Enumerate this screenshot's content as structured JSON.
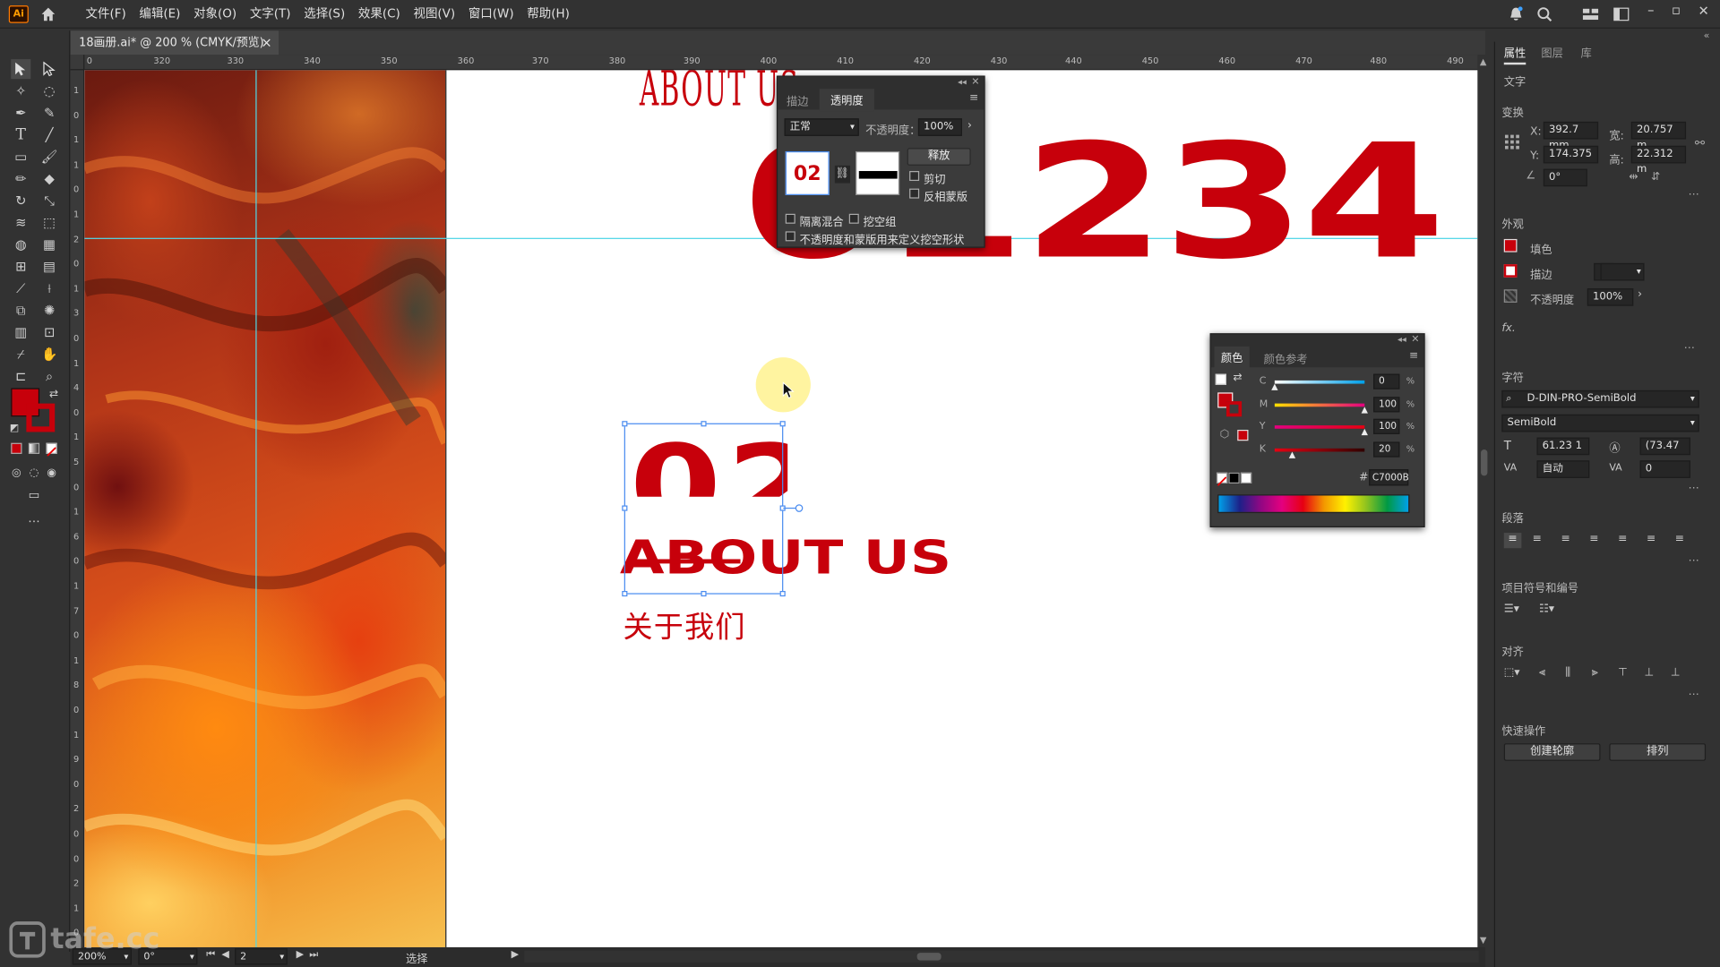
{
  "app": {
    "logo_text": "Ai"
  },
  "menu": [
    "文件(F)",
    "编辑(E)",
    "对象(O)",
    "文字(T)",
    "选择(S)",
    "效果(C)",
    "视图(V)",
    "窗口(W)",
    "帮助(H)"
  ],
  "document_tab": {
    "title": "18画册.ai* @ 200 % (CMYK/预览)",
    "close": "×"
  },
  "ruler": {
    "h_ticks": [
      "0",
      "320",
      "330",
      "340",
      "350",
      "360",
      "370",
      "380",
      "390",
      "400",
      "410",
      "420",
      "430",
      "440",
      "450",
      "460",
      "470",
      "480",
      "490"
    ],
    "v_ticks": [
      "1",
      "0",
      "1",
      "1",
      "0",
      "1",
      "2",
      "0",
      "1",
      "3",
      "0",
      "1",
      "4",
      "0",
      "1",
      "5",
      "0",
      "1",
      "6",
      "0",
      "1",
      "7",
      "0",
      "1",
      "8",
      "0",
      "1",
      "9",
      "0",
      "2",
      "0",
      "0",
      "2",
      "1",
      "0"
    ]
  },
  "canvas": {
    "about_top": "ABOUT US",
    "number_big": "01234",
    "number_02": "02",
    "about_us": "ABOUT US",
    "about_cn": "关于我们",
    "watermark": "tafe.cc"
  },
  "transparency_panel": {
    "tab_stroke": "描边",
    "tab_transparency": "透明度",
    "blend_mode": "正常",
    "opacity_label": "不透明度：",
    "opacity_value": "100%",
    "thumb_text": "02",
    "release_button": "释放",
    "clip_label": "剪切",
    "invert_label": "反相蒙版",
    "isolate_label": "隔离混合",
    "knockout_label": "挖空组",
    "define_knockout_label": "不透明度和蒙版用来定义挖空形状"
  },
  "color_panel": {
    "tab_color": "颜色",
    "tab_guide": "颜色参考",
    "channels": [
      {
        "label": "C",
        "value": "0",
        "unit": "%",
        "level": 0,
        "color_start": "#ffffff",
        "color_end": "#00a0e9"
      },
      {
        "label": "M",
        "value": "100",
        "unit": "%",
        "level": 1.0,
        "color_start": "#ffe000",
        "color_end": "#e4007f"
      },
      {
        "label": "Y",
        "value": "100",
        "unit": "%",
        "level": 1.0,
        "color_start": "#e4007f",
        "color_end": "#e60012"
      },
      {
        "label": "K",
        "value": "20",
        "unit": "%",
        "level": 0.2,
        "color_start": "#e60012",
        "color_end": "#300000"
      }
    ],
    "hex_label": "#",
    "hex_value": "C7000B"
  },
  "right_panel": {
    "tabs": [
      "属性",
      "图层",
      "库"
    ],
    "section_type": "文字",
    "transform": {
      "title": "变换",
      "x_label": "X:",
      "x_value": "392.7 mm",
      "y_label": "Y:",
      "y_value": "174.375",
      "w_label": "宽:",
      "w_value": "20.757 m",
      "h_label": "高:",
      "h_value": "22.312 m",
      "angle_value": "0°"
    },
    "appearance": {
      "title": "外观",
      "fill_label": "填色",
      "stroke_label": "描边",
      "opacity_label": "不透明度",
      "opacity_value": "100%",
      "fx_label": "fx."
    },
    "character": {
      "title": "字符",
      "font_family": "D-DIN-PRO-SemiBold",
      "font_style": "SemiBold",
      "size_value": "61.23 1",
      "leading_value": "(73.47",
      "tracking_value": "自动",
      "kerning_value": "0"
    },
    "paragraph": {
      "title": "段落"
    },
    "bullets": {
      "title": "项目符号和编号"
    },
    "align": {
      "title": "对齐"
    },
    "quick_actions": {
      "title": "快速操作",
      "outline_button": "创建轮廓",
      "arrange_button": "排列"
    }
  },
  "status_bar": {
    "zoom": "200%",
    "rotate": "0°",
    "artboard": "2",
    "mode": "选择"
  },
  "colors": {
    "brand_red": "#c7000b",
    "guide_cyan": "#4fd6e6",
    "selection_blue": "#4a8cf0"
  }
}
